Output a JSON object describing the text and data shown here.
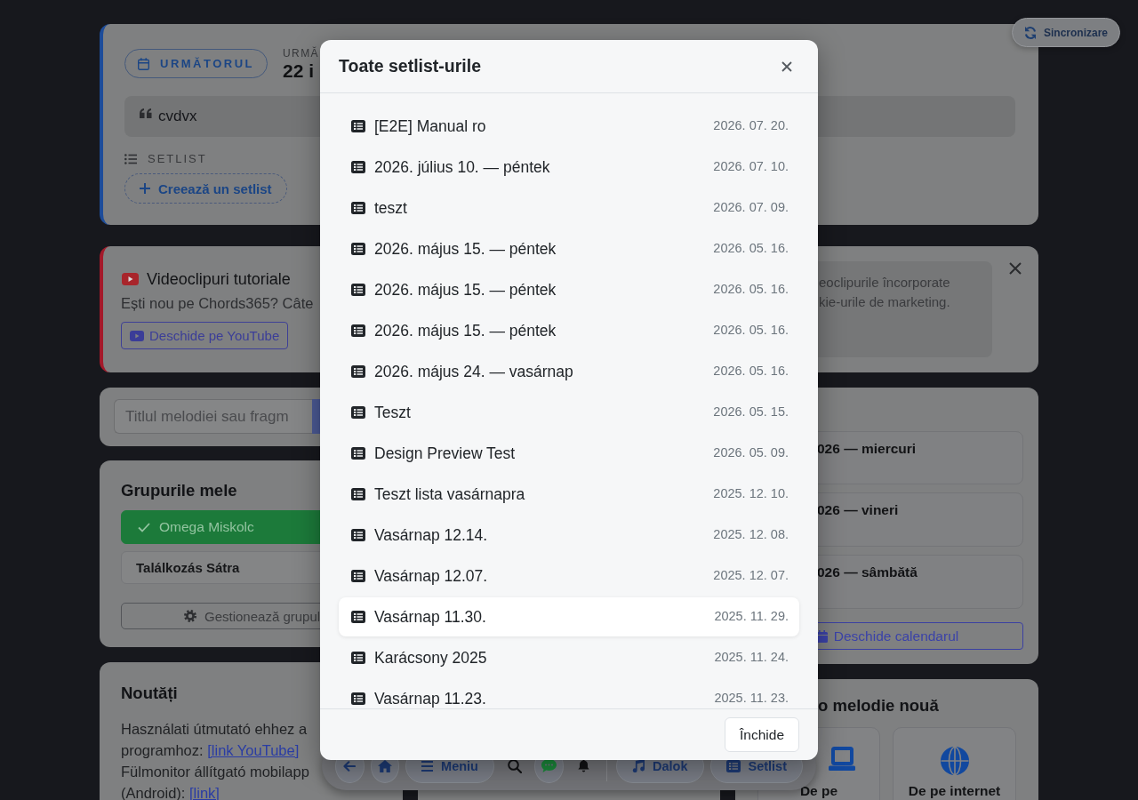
{
  "sync_button": {
    "label": "Sincronizare"
  },
  "next_event": {
    "badge": "URMĂTORUL",
    "label": "URMĂ",
    "date": "22 i",
    "note": "cvdvx",
    "setlist_label": "SETLIST",
    "create_button": "Creează un setlist"
  },
  "tutorials": {
    "title": "Videoclipuri tutoriale",
    "text": "Ești nou pe Chords365? Câte",
    "button": "Deschide pe YouTube",
    "notice_lines": [
      "eoclipurile încorporate",
      "kie-urile de marketing."
    ]
  },
  "search": {
    "placeholder": "Titlul melodiei sau fragm"
  },
  "groups": {
    "title": "Grupurile mele",
    "items": [
      {
        "name": "Omega Miskolc",
        "selected": true
      },
      {
        "name": "Találkozás Sátra",
        "selected": false
      }
    ],
    "manage_button": "Gestionează grupul"
  },
  "news": {
    "title": "Noutăți",
    "paragraphs": [
      {
        "text": "Használati útmutató ehhez a programhoz:",
        "link": "[link YouTube]"
      },
      {
        "text": "Fülmonitor állítgató mobilapp (Android):",
        "link": "[link]"
      }
    ]
  },
  "calendar": {
    "events": [
      "026 — miercuri",
      "026 — vineri",
      "026 — sâmbătă"
    ],
    "button": "Deschide calendarul"
  },
  "new_song": {
    "title": "o melodie nouă",
    "options": [
      "De pe",
      "De pe internet"
    ]
  },
  "bottom_nav": [
    {
      "kind": "circle"
    },
    {
      "kind": "circle"
    },
    {
      "kind": "pill",
      "label": "Meniu"
    },
    {
      "kind": "plain"
    },
    {
      "kind": "circle"
    },
    {
      "kind": "plain"
    },
    {
      "kind": "divider"
    },
    {
      "kind": "pill",
      "label": "Dalok"
    },
    {
      "kind": "pill",
      "label": "Setlist"
    }
  ],
  "modal": {
    "title": "Toate setlist-urile",
    "rows": [
      {
        "name": "[E2E] Manual ro",
        "date": "2026. 07. 20.",
        "highlighted": false
      },
      {
        "name": "2026. július 10. — péntek",
        "date": "2026. 07. 10.",
        "highlighted": false
      },
      {
        "name": "teszt",
        "date": "2026. 07. 09.",
        "highlighted": false
      },
      {
        "name": "2026. május 15. — péntek",
        "date": "2026. 05. 16.",
        "highlighted": false
      },
      {
        "name": "2026. május 15. — péntek",
        "date": "2026. 05. 16.",
        "highlighted": false
      },
      {
        "name": "2026. május 15. — péntek",
        "date": "2026. 05. 16.",
        "highlighted": false
      },
      {
        "name": "2026. május 24. — vasárnap",
        "date": "2026. 05. 16.",
        "highlighted": false
      },
      {
        "name": "Teszt",
        "date": "2026. 05. 15.",
        "highlighted": false
      },
      {
        "name": "Design Preview Test",
        "date": "2026. 05. 09.",
        "highlighted": false
      },
      {
        "name": "Teszt lista vasárnapra",
        "date": "2025. 12. 10.",
        "highlighted": false
      },
      {
        "name": "Vasárnap 12.14.",
        "date": "2025. 12. 08.",
        "highlighted": false
      },
      {
        "name": "Vasárnap 12.07.",
        "date": "2025. 12. 07.",
        "highlighted": false
      },
      {
        "name": "Vasárnap 11.30.",
        "date": "2025. 11. 29.",
        "highlighted": true
      },
      {
        "name": "Karácsony 2025",
        "date": "2025. 11. 24.",
        "highlighted": false
      },
      {
        "name": "Vasárnap 11.23.",
        "date": "2025. 11. 23.",
        "highlighted": false
      }
    ],
    "close_button": "Închide"
  }
}
